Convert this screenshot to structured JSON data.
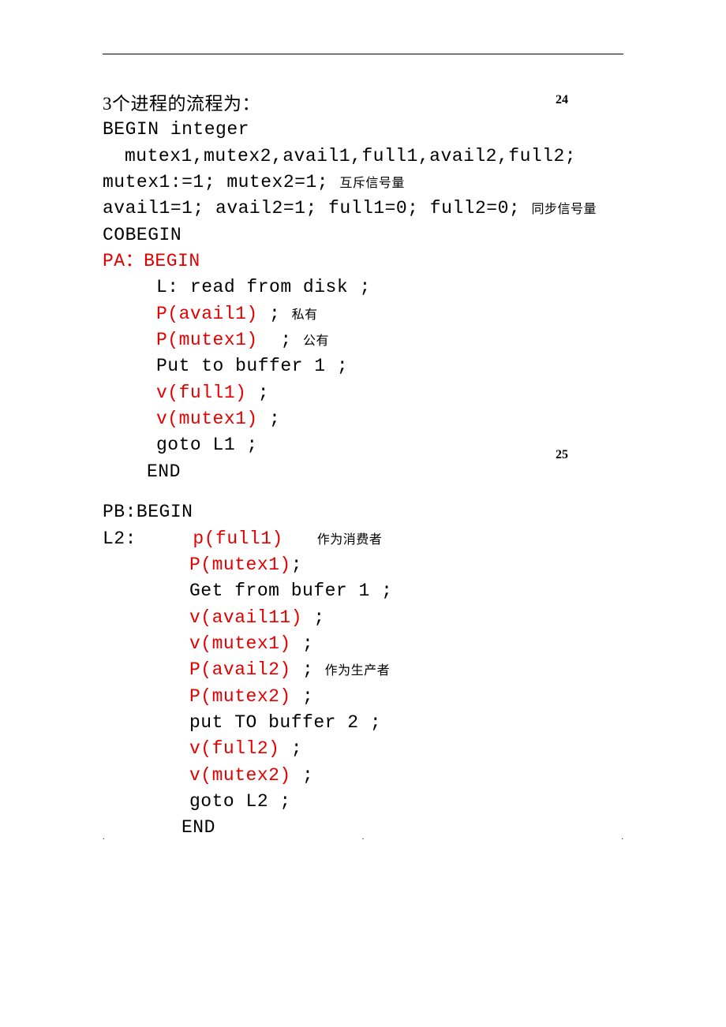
{
  "pageNum1": "24",
  "pageNum2": "25",
  "block1": {
    "l1": "3个进程的流程为：",
    "l2": "BEGIN integer",
    "l3": "mutex1,mutex2,avail1,full1,avail2,full2;",
    "l4a": "mutex1:=1; mutex2=1; ",
    "l4b": "互斥信号量",
    "l5a": "avail1=1; avail2=1; full1=0; full2=0; ",
    "l5b": "同步信号量",
    "l6": "COBEGIN",
    "l7": "PA：BEGIN",
    "l8": "L: read from disk ;",
    "l9a": "P(avail1) ",
    "l9b": "; ",
    "l9c": "私有",
    "l10a": "P(mutex1) ",
    "l10b": " ; ",
    "l10c": "公有",
    "l11": "Put to buffer 1 ;",
    "l12a": "v(full1) ",
    "l12b": ";",
    "l13a": "v(mutex1) ",
    "l13b": ";",
    "l14": "goto L1 ;",
    "l15": "END"
  },
  "block2": {
    "l1": "PB:BEGIN",
    "l2a": "L2:     ",
    "l2b": "p(full1)",
    "l2c": "   ",
    "l2d": "作为消费者",
    "l3a": "P(mutex1)",
    "l3b": ";",
    "l4": "Get from bufer 1 ;",
    "l5a": "v(avail11) ",
    "l5b": ";",
    "l6a": "v(mutex1) ",
    "l6b": ";",
    "l7a": "P(avail2) ",
    "l7b": "; ",
    "l7c": "作为生产者",
    "l8a": "P(mutex2) ",
    "l8b": ";",
    "l9": "put TO buffer 2 ;",
    "l10a": "v(full2) ",
    "l10b": ";",
    "l11a": "v(mutex2) ",
    "l11b": ";",
    "l12": "goto L2 ;",
    "l13": "END"
  }
}
